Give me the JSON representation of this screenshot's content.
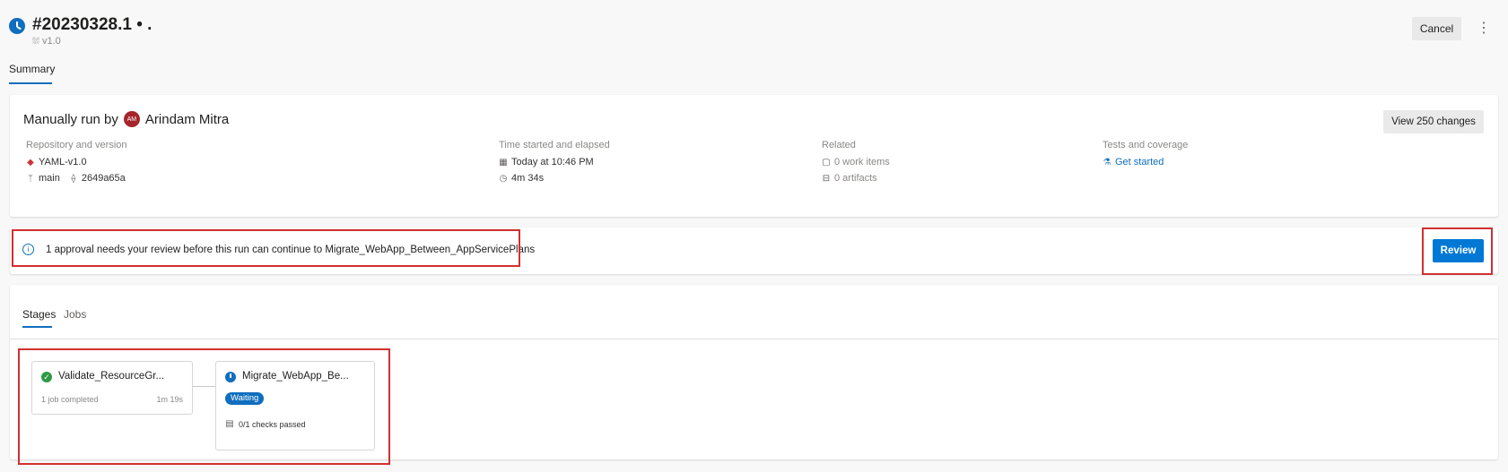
{
  "header": {
    "run_title": "#20230328.1 • .",
    "version": "v1.0",
    "cancel_label": "Cancel",
    "more_label": "⋮"
  },
  "tabs": {
    "summary": "Summary"
  },
  "summary": {
    "manual_prefix": "Manually run by",
    "avatar_initials": "AM",
    "user_name": "Arindam Mitra",
    "view_changes_label": "View 250 changes",
    "repository": {
      "heading": "Repository and version",
      "repo": "YAML-v1.0",
      "branch": "main",
      "commit": "2649a65a"
    },
    "time": {
      "heading": "Time started and elapsed",
      "started": "Today at 10:46 PM",
      "elapsed": "4m 34s"
    },
    "related": {
      "heading": "Related",
      "work_items": "0 work items",
      "artifacts": "0 artifacts"
    },
    "tests": {
      "heading": "Tests and coverage",
      "link": "Get started"
    }
  },
  "approval": {
    "message": "1 approval needs your review before this run can continue to Migrate_WebApp_Between_AppServicePlans",
    "review_label": "Review"
  },
  "stages_view": {
    "tabs": {
      "stages": "Stages",
      "jobs": "Jobs"
    },
    "stages": [
      {
        "name": "Validate_ResourceGr...",
        "status": "succeeded",
        "subtitle": "1 job completed",
        "duration": "1m 19s"
      },
      {
        "name": "Migrate_WebApp_Be...",
        "status": "waiting",
        "badge": "Waiting",
        "checks": "0/1 checks passed"
      }
    ]
  },
  "colors": {
    "accent": "#0078d4",
    "success": "#2f9a45",
    "highlight": "#d32f2f",
    "avatar": "#a4262c"
  }
}
